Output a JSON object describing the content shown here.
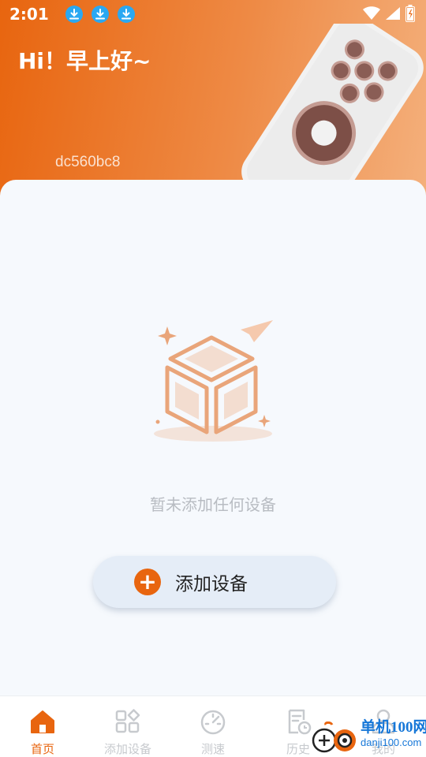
{
  "status_bar": {
    "time": "2:01",
    "download_icons": [
      "download-icon",
      "download-icon",
      "download-icon"
    ],
    "right_icons": [
      "wifi-icon",
      "signal-icon",
      "battery-icon"
    ]
  },
  "header": {
    "greeting": "Hi！早上好~",
    "device_id": "dc560bc8"
  },
  "main": {
    "empty_text": "暂未添加任何设备",
    "add_button_label": "添加设备"
  },
  "nav": {
    "items": [
      {
        "label": "首页",
        "icon": "home-icon",
        "active": true
      },
      {
        "label": "添加设备",
        "icon": "apps-icon",
        "active": false
      },
      {
        "label": "测速",
        "icon": "speedometer-icon",
        "active": false
      },
      {
        "label": "历史",
        "icon": "history-icon",
        "active": false
      },
      {
        "label": "我的",
        "icon": "user-icon",
        "active": false
      }
    ]
  },
  "watermark": {
    "title": "单机100网",
    "url": "danji100.com"
  },
  "colors": {
    "accent": "#e8650f",
    "button_bg": "#e5edf7",
    "inactive_nav": "#c7cace"
  }
}
